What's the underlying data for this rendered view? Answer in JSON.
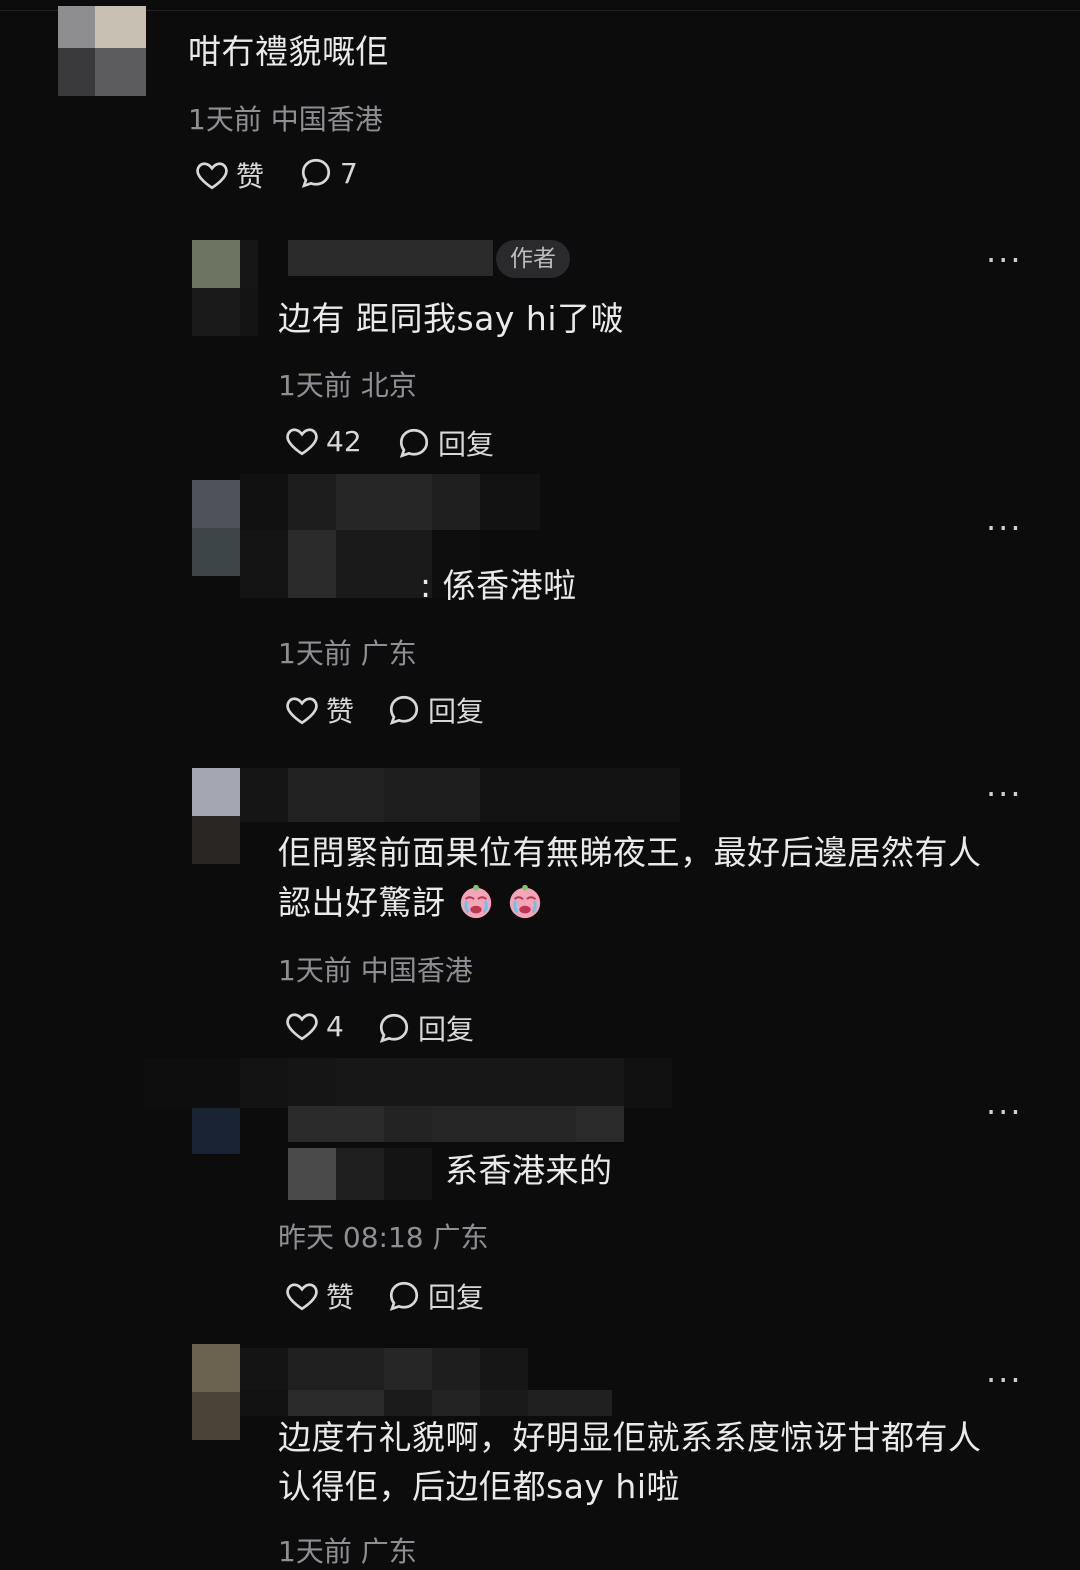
{
  "comment_main": {
    "text": "咁冇禮貌嘅佢",
    "meta": "1天前 中国香港",
    "like_label": "赞",
    "reply_count": "7"
  },
  "replies": [
    {
      "badge": "作者",
      "text": "边有 距同我say hi了啵",
      "meta": "1天前 北京",
      "like_label": "42",
      "reply_label": "回复"
    },
    {
      "text": ": 係香港啦",
      "meta": "1天前 广东",
      "like_label": "赞",
      "reply_label": "回复"
    },
    {
      "text_line1": "佢問緊前面果位有無睇夜王，最好后邊居然有人",
      "text_line2": "認出好驚訝",
      "meta": "1天前 中国香港",
      "like_label": "4",
      "reply_label": "回复"
    },
    {
      "text": "系香港来的",
      "meta": "昨天 08:18 广东",
      "like_label": "赞",
      "reply_label": "回复"
    },
    {
      "text_line1": "边度冇礼貌啊，好明显佢就系系度惊讶甘都有人",
      "text_line2": "认得佢，后边佢都say hi啦",
      "meta": "1天前 广东"
    }
  ],
  "more_glyph": "···",
  "icons": {
    "like": "heart-outline-icon",
    "reply": "speech-bubble-icon",
    "more": "more-dots-icon",
    "emoji": "crying-face-icon"
  },
  "colors": {
    "background": "#0c0c0d",
    "text": "#eaeaea",
    "meta": "#8f8f93",
    "badge_bg": "#2a2a2c"
  }
}
